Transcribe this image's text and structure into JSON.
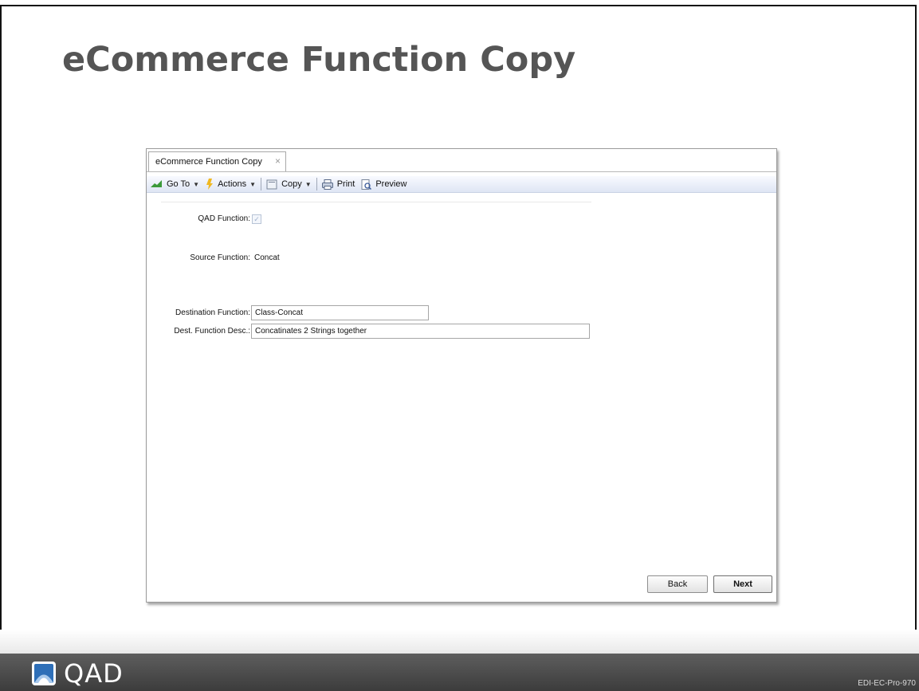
{
  "slide": {
    "title": "eCommerce Function Copy",
    "logo_text": "QAD",
    "code": "EDI-EC-Pro-970"
  },
  "window": {
    "tab_label": "eCommerce Function Copy",
    "tab_close": "×",
    "toolbar": {
      "goto_label": "Go To",
      "actions_label": "Actions",
      "copy_label": "Copy",
      "print_label": "Print",
      "preview_label": "Preview"
    },
    "form": {
      "qad_function_label": "QAD Function:",
      "qad_function_checked": true,
      "source_function_label": "Source Function:",
      "source_function_value": "Concat",
      "destination_function_label": "Destination Function:",
      "destination_function_value": "Class-Concat",
      "dest_desc_label": "Dest. Function Desc.:",
      "dest_desc_value": "Concatinates 2 Strings together"
    },
    "buttons": {
      "back_label": "Back",
      "next_label": "Next"
    }
  },
  "colors": {
    "title": "#555555",
    "footer": "#4a4a4a",
    "toolbar_accent": "#dfe6f4"
  },
  "icons": [
    "goto-icon",
    "actions-icon",
    "copy-icon",
    "print-icon",
    "preview-icon",
    "close-icon",
    "logo-mark-icon"
  ]
}
